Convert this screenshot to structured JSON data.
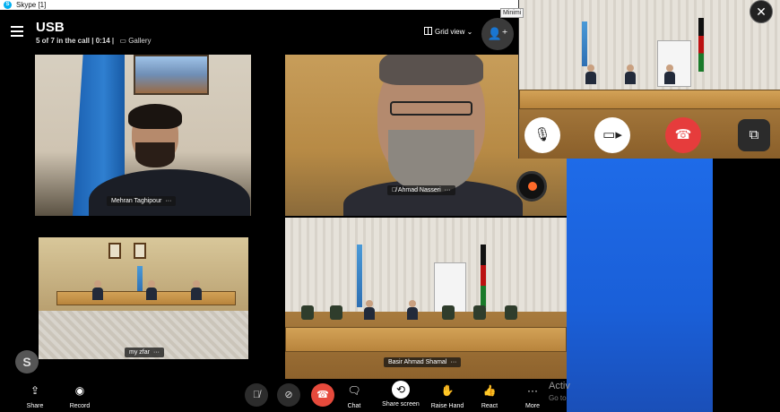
{
  "window": {
    "title": "Skype [1]",
    "minimize_tooltip": "Minimi"
  },
  "header": {
    "call_name": "USB",
    "participants_status": "5 of 7 in the call | 0:14 |",
    "layout_mode": "Gallery",
    "view_button": "Grid view"
  },
  "participants": [
    {
      "name": "Mehran Taghipour"
    },
    {
      "name": "Ahmad Nasseri"
    },
    {
      "name": "my zfar"
    },
    {
      "name": "Basir Ahmad Shamal"
    }
  ],
  "toolbar": {
    "share_label": "Share",
    "record_label": "Record",
    "chat_label": "Chat",
    "share_screen_label": "Share screen",
    "raise_hand_label": "Raise Hand",
    "react_label": "React",
    "more_label": "More"
  },
  "activation_text": "Activ",
  "activation_sub": "Go to",
  "icons": {
    "menu": "hamburger-icon",
    "add_people": "add-person-icon",
    "close": "close-icon",
    "mic": "microphone-icon",
    "video": "video-camera-icon",
    "end_call": "phone-hangup-icon",
    "popout": "switch-view-icon",
    "share": "share-icon",
    "record": "record-icon",
    "chat": "chat-icon",
    "share_screen": "share-screen-icon",
    "raise_hand": "raise-hand-icon",
    "react": "thumbs-up-icon",
    "more": "more-dots-icon"
  },
  "colors": {
    "end_call": "#e63c3c",
    "skype_blue": "#00aff0",
    "panel_blue": "#1e6be8"
  }
}
